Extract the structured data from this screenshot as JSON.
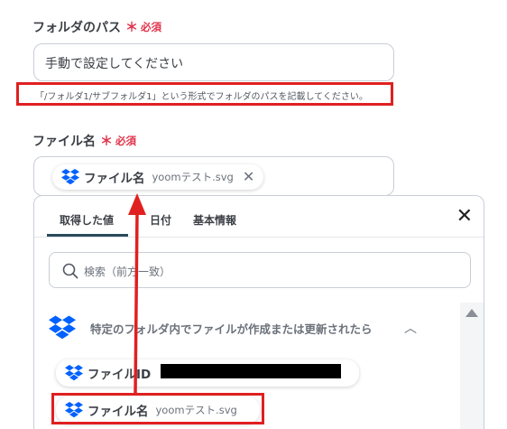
{
  "folder_path": {
    "label": "フォルダのパス",
    "required_star": "＊",
    "required_text": "必須",
    "value": "手動で設定してください",
    "hint": "「/フォルダ1/サブフォルダ1」という形式でフォルダのパスを記載してください。"
  },
  "file_name": {
    "label": "ファイル名",
    "required_star": "＊",
    "required_text": "必須",
    "chip_name": "ファイル名",
    "chip_value": "yoomテスト.svg",
    "chip_close": "✕"
  },
  "panel": {
    "tabs": [
      {
        "label": "取得した値",
        "active": true
      },
      {
        "label": "日付",
        "active": false
      },
      {
        "label": "基本情報",
        "active": false
      }
    ],
    "close": "✕",
    "search_placeholder": "検索（前方一致）",
    "group_title": "特定のフォルダ内でファイルが作成または更新されたら",
    "group_chevron": "︿",
    "items": [
      {
        "name": "ファイルID",
        "value": ""
      },
      {
        "name": "ファイル名",
        "value": "yoomテスト.svg"
      }
    ]
  },
  "colors": {
    "accent_red": "#e0334a",
    "annotation_red": "#e02020",
    "dropbox_blue": "#0061fe"
  },
  "icons": [
    "dropbox-icon",
    "search-icon",
    "close-icon",
    "chevron-up-icon"
  ]
}
